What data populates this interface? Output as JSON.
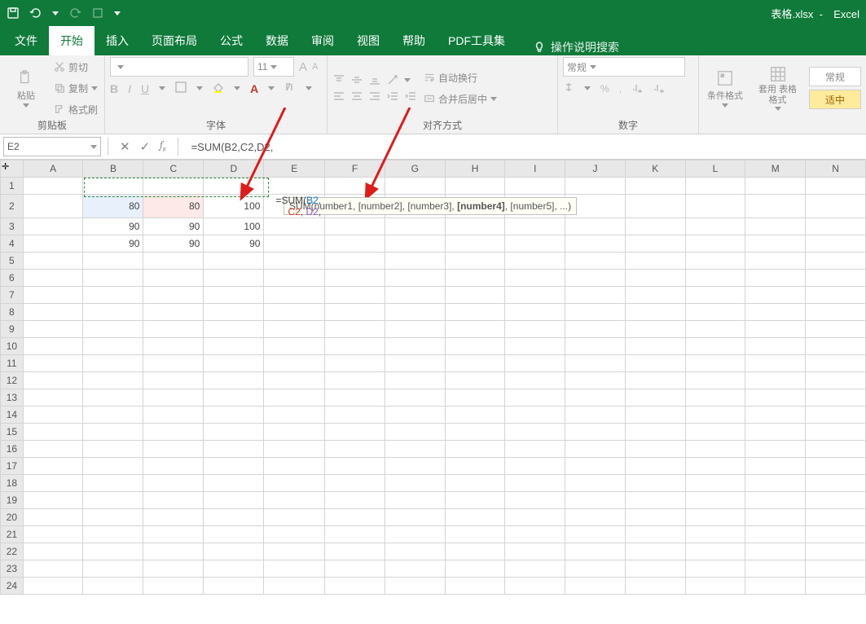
{
  "titlebar": {
    "doc_name": "表格.xlsx",
    "app_name": "Excel"
  },
  "tabs": {
    "file": "文件",
    "home": "开始",
    "insert": "插入",
    "layout": "页面布局",
    "formulas": "公式",
    "data": "数据",
    "review": "审阅",
    "view": "视图",
    "help": "帮助",
    "pdf": "PDF工具集",
    "tell_me": "操作说明搜索"
  },
  "ribbon": {
    "clipboard": {
      "paste": "粘贴",
      "cut": "剪切",
      "copy": "复制",
      "format_painter": "格式刷",
      "group_label": "剪贴板"
    },
    "font": {
      "family_placeholder": "",
      "size": "11",
      "group_label": "字体"
    },
    "alignment": {
      "wrap": "自动换行",
      "merge": "合并后居中",
      "group_label": "对齐方式"
    },
    "number": {
      "format": "常规",
      "group_label": "数字"
    },
    "styles": {
      "cond_fmt": "条件格式",
      "fmt_table": "套用\n表格格式",
      "normal": "常规",
      "good": "适中"
    }
  },
  "formula_bar": {
    "name_box": "E2",
    "formula_text": "=SUM(B2,C2,D2,"
  },
  "grid": {
    "columns": [
      "A",
      "B",
      "C",
      "D",
      "E",
      "F",
      "G",
      "H",
      "I",
      "J",
      "K",
      "L",
      "M",
      "N"
    ],
    "row_count": 24,
    "cells": {
      "B2": "80",
      "C2": "80",
      "D2": "100",
      "B3": "90",
      "C3": "90",
      "D3": "100",
      "B4": "90",
      "C4": "90",
      "D4": "90"
    },
    "edit_cell": {
      "address": "E2",
      "prefix": "=SUM(",
      "ref1": "B2",
      "ref2": "C2",
      "ref3": "D2",
      "suffix": ","
    },
    "tooltip": {
      "text": "SUM(number1, [number2], [number3], [number4], [number5], ...)",
      "bold_arg": "[number4]"
    }
  }
}
